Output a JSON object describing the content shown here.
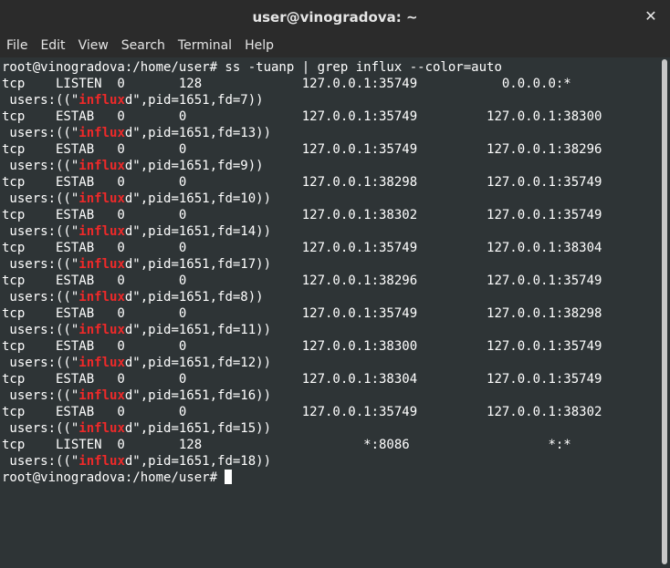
{
  "window": {
    "title": "user@vinogradova: ~",
    "close_glyph": "✕"
  },
  "menu": [
    "File",
    "Edit",
    "View",
    "Search",
    "Terminal",
    "Help"
  ],
  "terminal": {
    "command_line": "root@vinogradova:/home/user# ss -tuanp | grep influx --color=auto",
    "highlight_text": "influx",
    "highlight_color": "#ef2929",
    "rows": [
      {
        "main": "tcp    LISTEN  0       128             127.0.0.1:35749           0.0.0.0:*",
        "pre": " users:((\"",
        "post": "d\",pid=1651,fd=7))"
      },
      {
        "main": "tcp    ESTAB   0       0               127.0.0.1:35749         127.0.0.1:38300",
        "pre": " users:((\"",
        "post": "d\",pid=1651,fd=13))"
      },
      {
        "main": "tcp    ESTAB   0       0               127.0.0.1:35749         127.0.0.1:38296",
        "pre": " users:((\"",
        "post": "d\",pid=1651,fd=9))"
      },
      {
        "main": "tcp    ESTAB   0       0               127.0.0.1:38298         127.0.0.1:35749",
        "pre": " users:((\"",
        "post": "d\",pid=1651,fd=10))"
      },
      {
        "main": "tcp    ESTAB   0       0               127.0.0.1:38302         127.0.0.1:35749",
        "pre": " users:((\"",
        "post": "d\",pid=1651,fd=14))"
      },
      {
        "main": "tcp    ESTAB   0       0               127.0.0.1:35749         127.0.0.1:38304",
        "pre": " users:((\"",
        "post": "d\",pid=1651,fd=17))"
      },
      {
        "main": "tcp    ESTAB   0       0               127.0.0.1:38296         127.0.0.1:35749",
        "pre": " users:((\"",
        "post": "d\",pid=1651,fd=8))"
      },
      {
        "main": "tcp    ESTAB   0       0               127.0.0.1:35749         127.0.0.1:38298",
        "pre": " users:((\"",
        "post": "d\",pid=1651,fd=11))"
      },
      {
        "main": "tcp    ESTAB   0       0               127.0.0.1:38300         127.0.0.1:35749",
        "pre": " users:((\"",
        "post": "d\",pid=1651,fd=12))"
      },
      {
        "main": "tcp    ESTAB   0       0               127.0.0.1:38304         127.0.0.1:35749",
        "pre": " users:((\"",
        "post": "d\",pid=1651,fd=16))"
      },
      {
        "main": "tcp    ESTAB   0       0               127.0.0.1:35749         127.0.0.1:38302",
        "pre": " users:((\"",
        "post": "d\",pid=1651,fd=15))"
      },
      {
        "main": "tcp    LISTEN  0       128                     *:8086                  *:*",
        "pre": " users:((\"",
        "post": "d\",pid=1651,fd=18))"
      }
    ],
    "prompt": "root@vinogradova:/home/user# "
  }
}
